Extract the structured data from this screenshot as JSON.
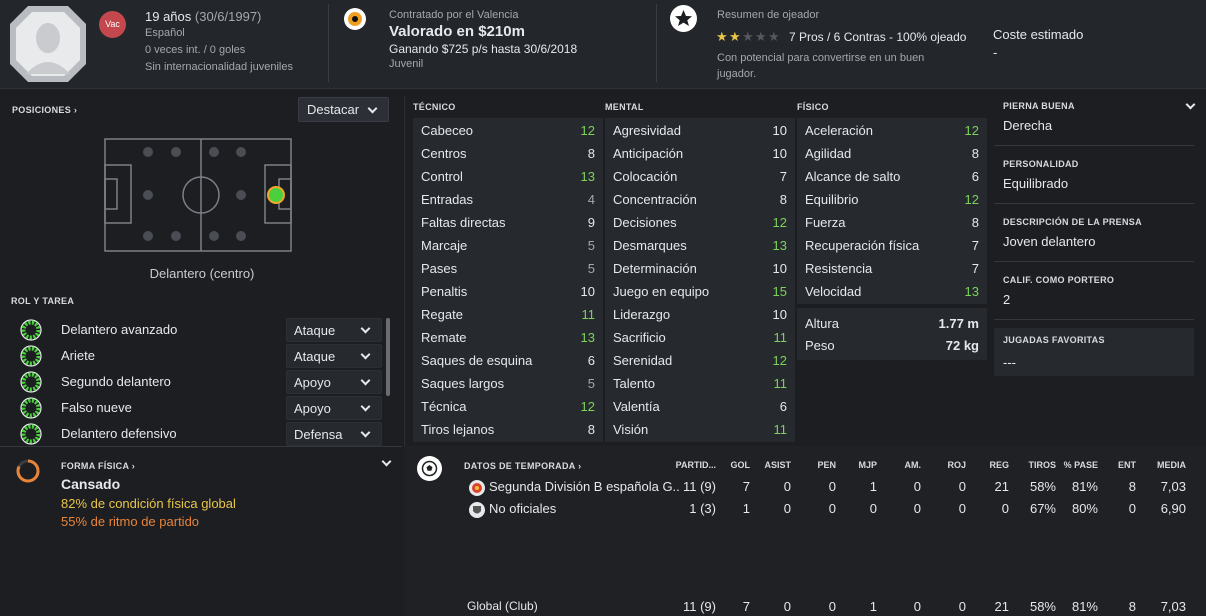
{
  "header": {
    "badge": "Vac",
    "age": "19 años",
    "dob": "(30/6/1997)",
    "nationality": "Español",
    "caps": "0 veces int. / 0 goles",
    "youth": "Sin internacionalidad juveniles",
    "contract_label": "Contratado por el Valencia",
    "value": "Valorado en $210m",
    "wage": "Ganando $725 p/s hasta 30/6/2018",
    "squad": "Juvenil",
    "scout_title": "Resumen de ojeador",
    "scout_summary": "7 Pros / 6 Contras - 100% ojeado",
    "scout_note": "Con potencial para convertirse en un buen jugador.",
    "stars_filled": 2,
    "stars_total": 5,
    "cost_label": "Coste estimado",
    "cost_value": "-"
  },
  "positions": {
    "title": "POSICIONES",
    "dropdown": "Destacar",
    "position_name": "Delantero (centro)"
  },
  "roles": {
    "title": "ROL Y TAREA",
    "items": [
      {
        "name": "Delantero avanzado",
        "duty": "Ataque"
      },
      {
        "name": "Ariete",
        "duty": "Ataque"
      },
      {
        "name": "Segundo delantero",
        "duty": "Apoyo"
      },
      {
        "name": "Falso nueve",
        "duty": "Apoyo"
      },
      {
        "name": "Delantero defensivo",
        "duty": "Defensa"
      }
    ]
  },
  "fitness": {
    "title": "FORMA FÍSICA",
    "status": "Cansado",
    "condition": "82% de condición física global",
    "sharpness": "55% de ritmo de partido",
    "condition_pct": 82
  },
  "attributes": {
    "technical_title": "TÉCNICO",
    "mental_title": "MENTAL",
    "physical_title": "FÍSICO",
    "technical": [
      {
        "name": "Cabeceo",
        "value": "12"
      },
      {
        "name": "Centros",
        "value": "8"
      },
      {
        "name": "Control",
        "value": "13"
      },
      {
        "name": "Entradas",
        "value": "4"
      },
      {
        "name": "Faltas directas",
        "value": "9"
      },
      {
        "name": "Marcaje",
        "value": "5"
      },
      {
        "name": "Pases",
        "value": "5"
      },
      {
        "name": "Penaltis",
        "value": "10"
      },
      {
        "name": "Regate",
        "value": "11"
      },
      {
        "name": "Remate",
        "value": "13"
      },
      {
        "name": "Saques de esquina",
        "value": "6"
      },
      {
        "name": "Saques largos",
        "value": "5"
      },
      {
        "name": "Técnica",
        "value": "12"
      },
      {
        "name": "Tiros lejanos",
        "value": "8"
      }
    ],
    "mental": [
      {
        "name": "Agresividad",
        "value": "10"
      },
      {
        "name": "Anticipación",
        "value": "10"
      },
      {
        "name": "Colocación",
        "value": "7"
      },
      {
        "name": "Concentración",
        "value": "8"
      },
      {
        "name": "Decisiones",
        "value": "12"
      },
      {
        "name": "Desmarques",
        "value": "13"
      },
      {
        "name": "Determinación",
        "value": "10"
      },
      {
        "name": "Juego en equipo",
        "value": "15"
      },
      {
        "name": "Liderazgo",
        "value": "10"
      },
      {
        "name": "Sacrificio",
        "value": "11"
      },
      {
        "name": "Serenidad",
        "value": "12"
      },
      {
        "name": "Talento",
        "value": "11"
      },
      {
        "name": "Valentía",
        "value": "6"
      },
      {
        "name": "Visión",
        "value": "11"
      }
    ],
    "physical": [
      {
        "name": "Aceleración",
        "value": "12"
      },
      {
        "name": "Agilidad",
        "value": "8"
      },
      {
        "name": "Alcance de salto",
        "value": "6"
      },
      {
        "name": "Equilibrio",
        "value": "12"
      },
      {
        "name": "Fuerza",
        "value": "8"
      },
      {
        "name": "Recuperación física",
        "value": "7"
      },
      {
        "name": "Resistencia",
        "value": "7"
      },
      {
        "name": "Velocidad",
        "value": "13"
      }
    ],
    "height_label": "Altura",
    "height_value": "1.77 m",
    "weight_label": "Peso",
    "weight_value": "72 kg"
  },
  "right_panel": {
    "foot_title": "PIERNA BUENA",
    "foot_value": "Derecha",
    "personality_title": "PERSONALIDAD",
    "personality_value": "Equilibrado",
    "media_title": "DESCRIPCIÓN DE LA PRENSA",
    "media_value": "Joven delantero",
    "gk_title": "CALIF. COMO PORTERO",
    "gk_value": "2",
    "ppm_title": "JUGADAS FAVORITAS",
    "ppm_value": "---"
  },
  "season": {
    "title": "DATOS DE TEMPORADA",
    "columns": [
      "PARTID...",
      "GOL",
      "ASIST",
      "PEN",
      "MJP",
      "AM.",
      "ROJ",
      "REG",
      "TIROS",
      "% PASE",
      "ENT",
      "MEDIA"
    ],
    "rows": [
      {
        "competition": "Segunda División B española G...",
        "cells": [
          "11 (9)",
          "7",
          "0",
          "0",
          "1",
          "0",
          "0",
          "21",
          "58%",
          "81%",
          "8",
          "7,03"
        ]
      },
      {
        "competition": "No oficiales",
        "cells": [
          "1 (3)",
          "1",
          "0",
          "0",
          "0",
          "0",
          "0",
          "0",
          "67%",
          "80%",
          "0",
          "6,90"
        ]
      }
    ],
    "total_label": "Global (Club)",
    "total_cells": [
      "11 (9)",
      "7",
      "0",
      "0",
      "1",
      "0",
      "0",
      "21",
      "58%",
      "81%",
      "8",
      "7,03"
    ]
  },
  "colors": {
    "accent_green": "#7dd35a",
    "condition_yellow": "#e8c648",
    "sharpness_orange": "#e8843a",
    "badge_red": "#c3474c"
  }
}
